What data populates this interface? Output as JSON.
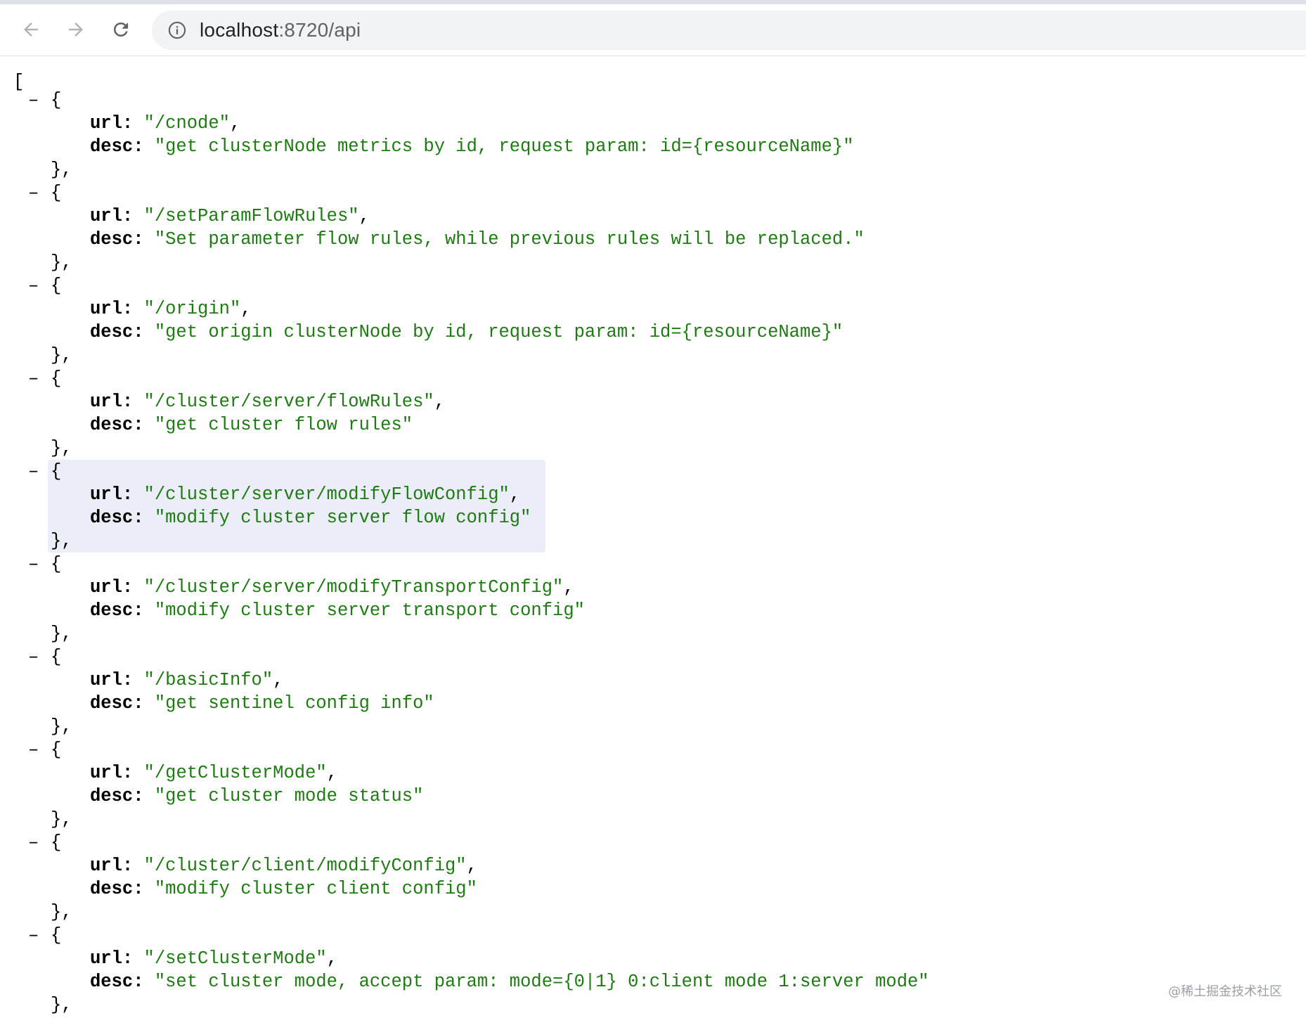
{
  "browser": {
    "url_host": "localhost",
    "url_rest": ":8720/api"
  },
  "json_view": {
    "open_bracket": "[",
    "dash": "–",
    "open_brace": "{",
    "close_brace": "},",
    "url_key": "url:",
    "desc_key": "desc:",
    "entries": [
      {
        "url": "\"/cnode\"",
        "desc": "\"get clusterNode metrics by id, request param: id={resourceName}\""
      },
      {
        "url": "\"/setParamFlowRules\"",
        "desc": "\"Set parameter flow rules, while previous rules will be replaced.\""
      },
      {
        "url": "\"/origin\"",
        "desc": "\"get origin clusterNode by id, request param: id={resourceName}\""
      },
      {
        "url": "\"/cluster/server/flowRules\"",
        "desc": "\"get cluster flow rules\""
      },
      {
        "url": "\"/cluster/server/modifyFlowConfig\"",
        "desc": "\"modify cluster server flow config\""
      },
      {
        "url": "\"/cluster/server/modifyTransportConfig\"",
        "desc": "\"modify cluster server transport config\""
      },
      {
        "url": "\"/basicInfo\"",
        "desc": "\"get sentinel config info\""
      },
      {
        "url": "\"/getClusterMode\"",
        "desc": "\"get cluster mode status\""
      },
      {
        "url": "\"/cluster/client/modifyConfig\"",
        "desc": "\"modify cluster client config\""
      },
      {
        "url": "\"/setClusterMode\"",
        "desc": "\"set cluster mode, accept param: mode={0|1} 0:client mode 1:server mode\""
      }
    ]
  },
  "watermark": "@稀土掘金技术社区"
}
